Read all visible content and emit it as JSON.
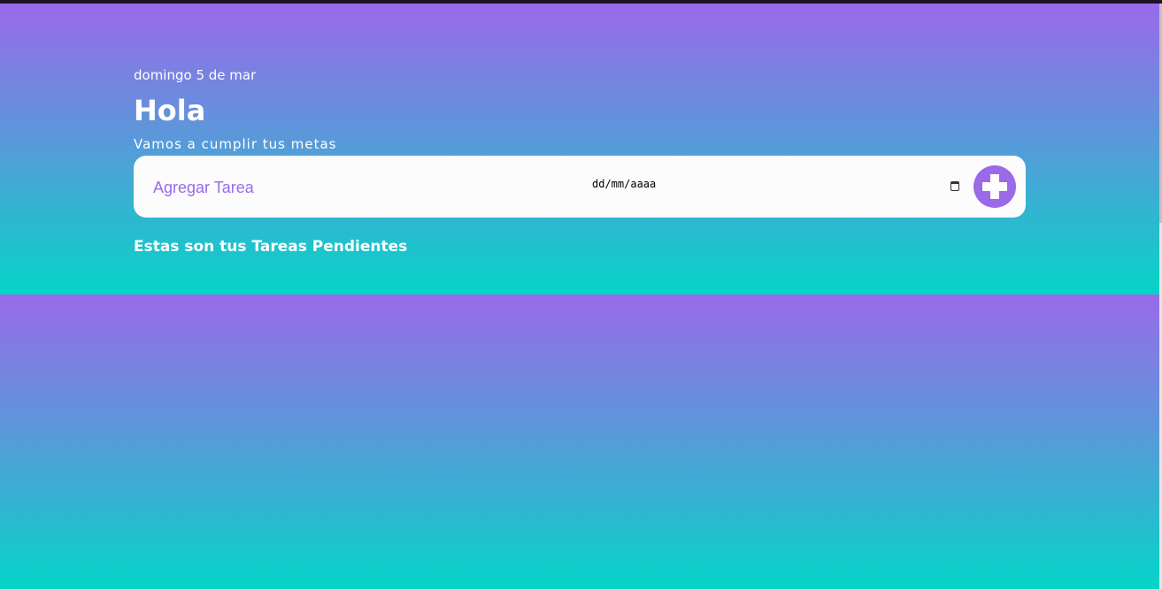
{
  "header": {
    "date": "domingo 5 de mar",
    "greeting": "Hola",
    "subtitle": "Vamos a cumplir tus metas"
  },
  "form": {
    "task_placeholder": "Agregar Tarea",
    "date_placeholder": "dd/mm/aaaa",
    "add_icon": "plus-circle-icon"
  },
  "pending_title": "Estas son tus Tareas Pendientes",
  "colors": {
    "accent": "#9a6ae9",
    "gradient_end": "#05d4c7"
  }
}
